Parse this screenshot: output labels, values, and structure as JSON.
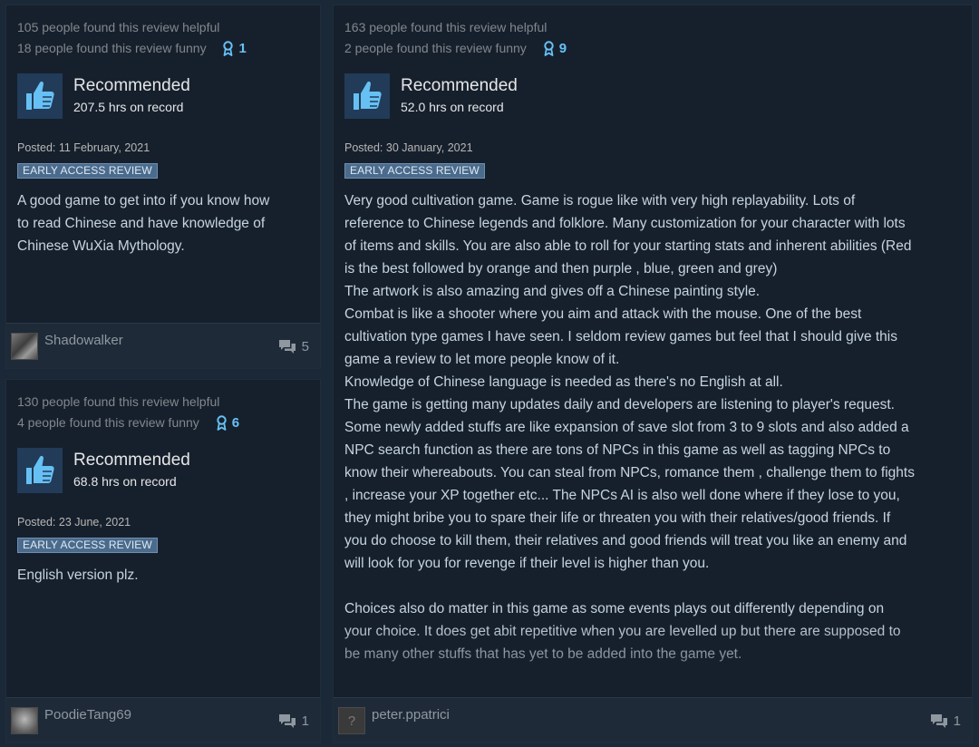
{
  "colors": {
    "page_bg": "#1b2838",
    "card_bg": "#16202d",
    "accent_blue": "#67c1f5",
    "badge_bg": "#4a6b8c",
    "thumb_bg": "#223b58"
  },
  "reviews": [
    {
      "helpful": "105 people found this review helpful",
      "funny": "18 people found this review funny",
      "awards": "1",
      "verdict": "Recommended",
      "hours": "207.5 hrs on record",
      "posted": "Posted: 11 February, 2021",
      "badge": "EARLY ACCESS REVIEW",
      "body": "A good game to get into if you know how\nto read Chinese and have knowledge of\nChinese WuXia Mythology.",
      "author": "Shadowalker",
      "comments": "5",
      "icons": {
        "award": "award-ribbon-icon",
        "thumb": "thumbs-up-icon",
        "comment": "comment-bubbles-icon"
      }
    },
    {
      "helpful": "130 people found this review helpful",
      "funny": "4 people found this review funny",
      "awards": "6",
      "verdict": "Recommended",
      "hours": "68.8 hrs on record",
      "posted": "Posted: 23 June, 2021",
      "badge": "EARLY ACCESS REVIEW",
      "body": "English version plz.",
      "author": "PoodieTang69",
      "comments": "1",
      "icons": {
        "award": "award-ribbon-icon",
        "thumb": "thumbs-up-icon",
        "comment": "comment-bubbles-icon"
      }
    },
    {
      "helpful": "163 people found this review helpful",
      "funny": "2 people found this review funny",
      "awards": "9",
      "verdict": "Recommended",
      "hours": "52.0 hrs on record",
      "posted": "Posted: 30 January, 2021",
      "badge": "EARLY ACCESS REVIEW",
      "body": "Very good cultivation game. Game is rogue like with very high replayability. Lots of\nreference to Chinese legends and folklore. Many customization for your character with lots\nof items and skills. You are also able to roll for your starting stats and inherent abilities (Red\nis the best followed by orange and then purple , blue, green and grey)\nThe artwork is also amazing and gives off a Chinese painting style.\nCombat is like a shooter where you aim and attack with the mouse. One of the best\ncultivation type games I have seen. I seldom review games but feel that I should give this\ngame a review to let more people know of it.\nKnowledge of Chinese language is needed as there's no English at all.\nThe game is getting many updates daily and developers are listening to player's request.\nSome newly added stuffs are like expansion of save slot from 3 to 9 slots and also added a\nNPC search function as there are tons of NPCs in this game as well as tagging NPCs to\nknow their whereabouts. You can steal from NPCs, romance them , challenge them to fights\n, increase your XP together etc... The NPCs AI is also well done where if they lose to you,\nthey might bribe you to spare their life or threaten you with their relatives/good friends. If\nyou do choose to kill them, their relatives and good friends will treat you like an enemy and\nwill look for you for revenge if their level is higher than you.\n\nChoices also do matter in this game as some events plays out differently depending on\nyour choice. It does get abit repetitive when you are levelled up but there are supposed to\nbe many other stuffs that has yet to be added into the game yet.",
      "author": "peter.ppatrici",
      "avatar_glyph": "?",
      "comments": "1",
      "icons": {
        "award": "award-ribbon-icon",
        "thumb": "thumbs-up-icon",
        "comment": "comment-bubbles-icon"
      }
    }
  ]
}
